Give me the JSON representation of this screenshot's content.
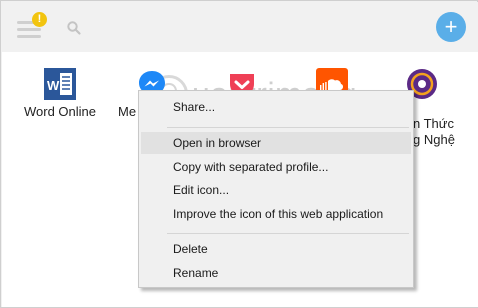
{
  "topbar": {
    "notification_badge": "!",
    "add_label": "+"
  },
  "watermark": {
    "text": "uantrimang"
  },
  "apps": [
    {
      "label": "Word Online",
      "icon": "word-online-icon"
    },
    {
      "label": "Me",
      "icon": "messenger-icon"
    },
    {
      "label": "",
      "icon": "pocket-icon"
    },
    {
      "label": "",
      "icon": "soundcloud-icon"
    },
    {
      "label_line1": "n Thức",
      "label_line2": "g Nghệ",
      "icon": "knowledge-app-icon"
    }
  ],
  "context_menu": {
    "items": [
      {
        "label": "Share..."
      },
      {
        "label": "Open in browser"
      },
      {
        "label": "Copy with separated profile..."
      },
      {
        "label": "Edit icon..."
      },
      {
        "label": "Improve the icon of this web application"
      },
      {
        "label": "Delete"
      },
      {
        "label": "Rename"
      }
    ]
  },
  "colors": {
    "accent_blue": "#5aaee8",
    "badge_yellow": "#f2c40f",
    "word_blue": "#2b579a",
    "messenger_blue": "#1e88f7",
    "pocket_red": "#ef4056",
    "soundcloud_orange": "#ff5500",
    "knowledge_purple": "#5b2a86",
    "menu_highlight": "#e1e1e1"
  }
}
